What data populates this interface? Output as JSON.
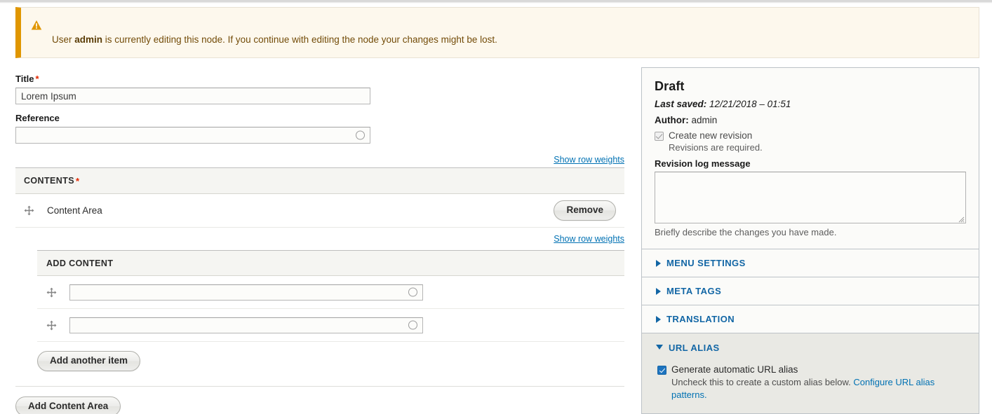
{
  "warning": {
    "icon": "warning-triangle-icon",
    "text_before": "User ",
    "user": "admin",
    "text_after": " is currently editing this node. If you continue with editing the node your changes might be lost.",
    "accent_color": "#e09600",
    "background_color": "#fdf8ed"
  },
  "form": {
    "title_field": {
      "label": "Title",
      "required_marker": "*",
      "value": "Lorem Ipsum",
      "placeholder": ""
    },
    "reference_field": {
      "label": "Reference",
      "value": "",
      "placeholder": "",
      "icon": "autocomplete-throbber-icon"
    },
    "show_row_weights_top": "Show row weights",
    "contents_table": {
      "header_label": "CONTENTS",
      "required_marker": "*",
      "rows": [
        {
          "drag_icon": "drag-handle-icon",
          "title": "Content Area",
          "remove_label": "Remove"
        }
      ]
    },
    "show_row_weights_inner": "Show row weights",
    "add_content_table": {
      "header_label": "ADD CONTENT",
      "rows": [
        {
          "drag_icon": "drag-handle-icon",
          "value": "",
          "placeholder": ""
        },
        {
          "drag_icon": "drag-handle-icon",
          "value": "",
          "placeholder": ""
        }
      ]
    },
    "add_another_item_label": "Add another item",
    "add_content_area_label": "Add Content Area"
  },
  "sidebar": {
    "draft": {
      "title": "Draft",
      "last_saved_label": "Last saved:",
      "last_saved_value": " 12/21/2018 – 01:51",
      "author_label": "Author:",
      "author_value": " admin",
      "create_revision_label": "Create new revision",
      "create_revision_checked": true,
      "create_revision_disabled": true,
      "revisions_required_note": "Revisions are required.",
      "revision_log_label": "Revision log message",
      "revision_log_value": "",
      "revision_log_placeholder": "",
      "revision_log_description": "Briefly describe the changes you have made."
    },
    "accordions": [
      {
        "label": "MENU SETTINGS",
        "expanded": false,
        "icon": "chevron-right-icon"
      },
      {
        "label": "META TAGS",
        "expanded": false,
        "icon": "chevron-right-icon"
      },
      {
        "label": "TRANSLATION",
        "expanded": false,
        "icon": "chevron-right-icon"
      }
    ],
    "url_alias": {
      "label": "URL ALIAS",
      "expanded": true,
      "icon": "chevron-down-icon",
      "generate_label": "Generate automatic URL alias",
      "generate_checked": true,
      "description_text": "Uncheck this to create a custom alias below. ",
      "link_text": "Configure URL alias patterns."
    },
    "link_color": "#0071b3",
    "heading_color": "#1266a5"
  }
}
